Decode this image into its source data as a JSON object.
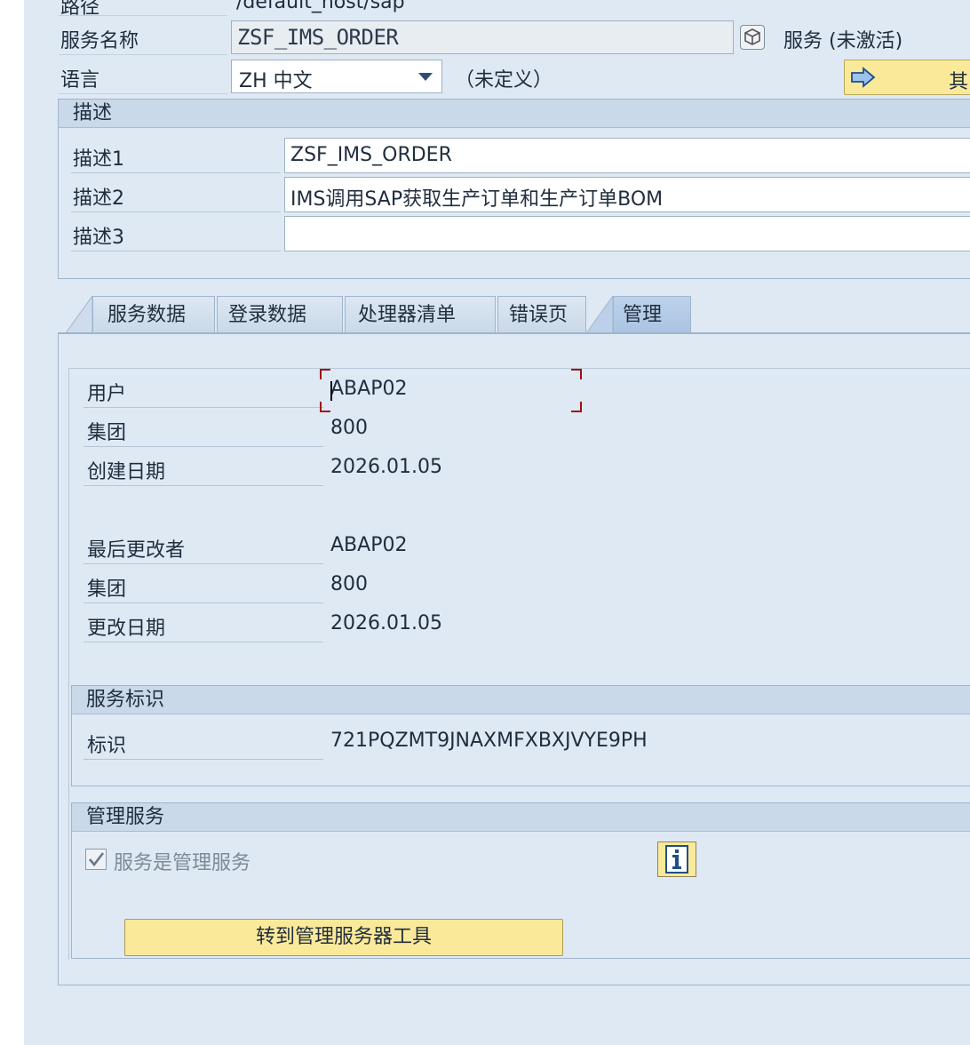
{
  "header": {
    "path_label": "路径",
    "path_value": "/default_host/sap",
    "service_label": "服务名称",
    "service_value": "ZSF_IMS_ORDER",
    "service_status": "服务 (未激活)",
    "language_label": "语言",
    "language_value": "ZH 中文",
    "language_note": "（未定义）",
    "other_button_label": "其"
  },
  "description": {
    "title": "描述",
    "rows": [
      {
        "label": "描述1",
        "value": "ZSF_IMS_ORDER"
      },
      {
        "label": "描述2",
        "value": "IMS调用SAP获取生产订单和生产订单BOM"
      },
      {
        "label": "描述3",
        "value": ""
      }
    ]
  },
  "tabs": [
    {
      "label": "服务数据"
    },
    {
      "label": "登录数据"
    },
    {
      "label": "处理器清单"
    },
    {
      "label": "错误页"
    },
    {
      "label": "管理"
    }
  ],
  "admin": {
    "created": [
      {
        "label": "用户",
        "value": "ABAP02"
      },
      {
        "label": "集团",
        "value": "800"
      },
      {
        "label": "创建日期",
        "value": "2026.01.05"
      }
    ],
    "changed": [
      {
        "label": "最后更改者",
        "value": "ABAP02"
      },
      {
        "label": "集团",
        "value": "800"
      },
      {
        "label": "更改日期",
        "value": "2026.01.05"
      }
    ],
    "service_id_group": {
      "title": "服务标识",
      "label": "标识",
      "value": "721PQZMT9JNAXMFXBXJVYE9PH"
    },
    "mgmt_group": {
      "title": "管理服务",
      "checkbox_label": "服务是管理服务",
      "checkbox_checked": true,
      "goto_button": "转到管理服务器工具"
    }
  },
  "icons": {
    "service_icon": "cube-icon",
    "other_button_icon": "arrow-right-icon",
    "info_icon": "info-icon"
  }
}
